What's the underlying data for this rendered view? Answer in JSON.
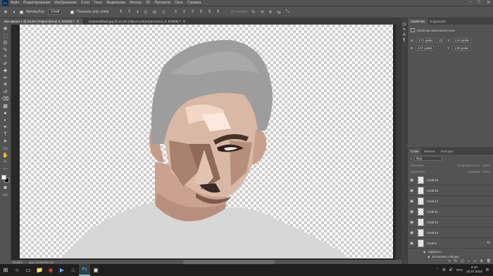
{
  "menubar": {
    "logo": "Ps",
    "items": [
      "Файл",
      "Редактирование",
      "Изображение",
      "Слои",
      "Текст",
      "Выделение",
      "Фильтр",
      "3D",
      "Просмотр",
      "Окно",
      "Справка"
    ],
    "window_controls": [
      "–",
      "□",
      "✕"
    ]
  },
  "options": {
    "autoselect_label": "Автовыбор:",
    "autoselect_value": "Слой",
    "show_controls_label": "Показать упр. элем.",
    "mode_3d": "3D-режим:"
  },
  "tabs": [
    {
      "label": "Без имени-1 @ 55,5% (Черно-белое 2, RGB/8) *",
      "active": true
    },
    {
      "label": "maxresdefault.jpg @ 41,2% (Яркость/Контрастность 3, RGB/8) *",
      "active": false
    }
  ],
  "toolbar": {
    "tools": [
      "move-icon",
      "marquee-icon",
      "lasso-icon",
      "quick-select-icon",
      "crop-icon",
      "eyedropper-icon",
      "healing-icon",
      "brush-icon",
      "stamp-icon",
      "history-brush-icon",
      "eraser-icon",
      "gradient-icon",
      "blur-icon",
      "dodge-icon",
      "pen-icon",
      "type-icon",
      "path-select-icon",
      "shape-icon",
      "hand-icon",
      "zoom-icon"
    ],
    "glyphs": [
      "✥",
      "⬚",
      "ʘ",
      "✎",
      "⌗",
      "✐",
      "✚",
      "✏",
      "⎈",
      "↺",
      "⌫",
      "▦",
      "●",
      "◐",
      "✒",
      "T",
      "➤",
      "▭",
      "✋",
      "⌕"
    ]
  },
  "status": {
    "zoom": "55,46%",
    "doc": "Док: 00,0M/205,2M"
  },
  "properties": {
    "tabs": [
      "Свойства",
      "Коррекция"
    ],
    "title": "Свойства пиксельного слоя",
    "W_label": "Ш:",
    "W": "3,71 дюйм",
    "H_label": "В:",
    "H": "4,67 дюйм",
    "X_label": "X:",
    "X": "2,56 дюйм",
    "Y_label": "Y:",
    "Y": "1,50 дюйм",
    "link": "GO"
  },
  "layers": {
    "tabs": [
      "Слои",
      "Каналы",
      "Контуры"
    ],
    "filter_label": "Вид",
    "blend_mode": "Обычные",
    "opacity_label": "Непрозрачность:",
    "opacity": "100%",
    "fill_label": "Заливка:",
    "fill": "100%",
    "lock_label": "Закрепить:",
    "items": [
      "Слой 10",
      "Слой 15",
      "Слой 14",
      "Слой 11",
      "Слой 12",
      "Слой 13",
      "Слой 8"
    ],
    "effects_label": "Эффекты",
    "effect_item": "Выполнить обводку",
    "fx": "fx"
  },
  "taskbar": {
    "icons": [
      "windows-logo-icon",
      "search-icon",
      "task-view-icon",
      "file-explorer-icon",
      "chrome-icon",
      "media-icon",
      "steam-icon",
      "photoshop-icon",
      "photos-icon"
    ],
    "glyphs": [
      "⊞",
      "○",
      "▭",
      "📁",
      "◉",
      "▶",
      "♨",
      "Ps",
      "▣"
    ],
    "tray_lang": "РУС",
    "time": "6:10",
    "date": "22.07.2018"
  },
  "colors": {
    "ui_bg": "#535353",
    "canvas_bg": "#282828",
    "hair": "#9d9d9d",
    "shirt": "#d7d7d7",
    "skin_base": "#d9b8a6"
  }
}
